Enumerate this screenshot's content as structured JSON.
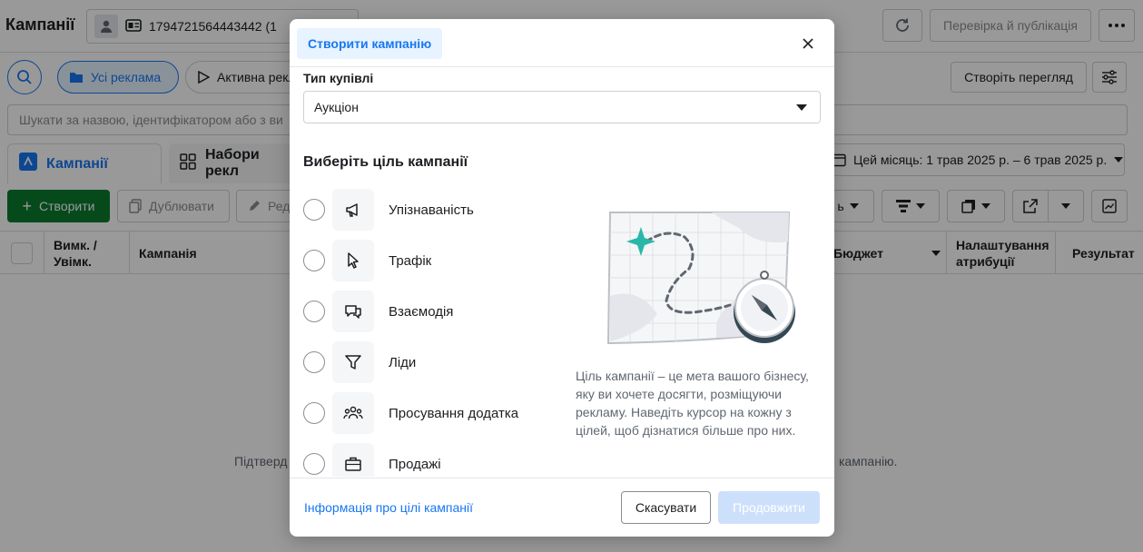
{
  "app": {
    "title": "Кампанії",
    "account_id": "1794721564443442 (1",
    "review_button": "Перевірка й публікація"
  },
  "filters": {
    "all_ads": "Усі реклама",
    "active_ads": "Активна рекл",
    "create_view": "Створіть перегляд",
    "search_placeholder": "Шукати за назвою, ідентифікатором або з ви"
  },
  "tabs": {
    "campaigns": "Кампанії",
    "ad_sets": "Набори рекл"
  },
  "date_range": "Цей місяць: 1 трав 2025 р. – 6 трав 2025 р.",
  "toolbar": {
    "create": "Створити",
    "duplicate": "Дублювати",
    "edit": "Ред",
    "partial": "ь"
  },
  "table": {
    "col_toggle": "Вимк. / Увімк.",
    "col_campaign": "Кампанія",
    "col_budget": "Бюджет",
    "col_attribution": "Налаштування атрибуції",
    "col_results": "Результат",
    "empty_left": "Підтверд",
    "empty_right": "кампанію."
  },
  "modal": {
    "header_tab": "Створити кампанію",
    "buy_type_label": "Тип купівлі",
    "buy_type_value": "Аукціон",
    "objective_heading": "Виберіть ціль кампанії",
    "objectives": [
      {
        "label": "Упізнаваність",
        "icon": "megaphone-icon"
      },
      {
        "label": "Трафік",
        "icon": "cursor-icon"
      },
      {
        "label": "Взаємодія",
        "icon": "chat-bubbles-icon"
      },
      {
        "label": "Ліди",
        "icon": "funnel-icon"
      },
      {
        "label": "Просування додатка",
        "icon": "people-icon"
      },
      {
        "label": "Продажі",
        "icon": "briefcase-icon"
      }
    ],
    "description": "Ціль кампанії – це мета вашого бізнесу, яку ви хочете досягти, розміщуючи рекламу. Наведіть курсор на кожну з цілей, щоб дізнатися більше про них.",
    "footer_link": "Інформація про цілі кампанії",
    "cancel": "Скасувати",
    "continue": "Продовжити"
  },
  "colors": {
    "accent": "#1877f2",
    "create_green": "#0a7c2f",
    "disabled_blue": "#cde0fb"
  }
}
